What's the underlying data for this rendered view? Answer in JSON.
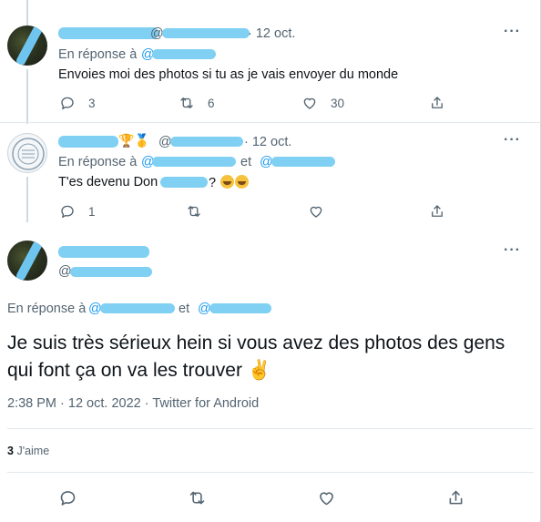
{
  "tweet1": {
    "handle_prefix": "@",
    "date": "· 12 oct.",
    "reply_label": "En réponse à",
    "reply_at": "@",
    "text": "Envoies moi des photos si tu as je vais envoyer du monde",
    "replies": "3",
    "retweets": "6",
    "likes": "30"
  },
  "tweet2": {
    "badges": "🏆🥇",
    "handle_prefix": "@",
    "date": "· 12 oct.",
    "reply_label": "En réponse à",
    "reply_at1": "@",
    "reply_and": "et",
    "reply_at2": "@",
    "text_start": "T'es devenu Don",
    "text_end": "?",
    "replies": "1"
  },
  "main_tweet": {
    "handle_prefix": "@",
    "reply_label": "En réponse à",
    "reply_at1": "@",
    "reply_and": "et",
    "reply_at2": "@",
    "text": "Je suis très sérieux hein si vous avez des photos des gens qui font ça on va les trouver",
    "emoji": "✌️",
    "timestamp": "2:38 PM · 12 oct. 2022 · Twitter for Android",
    "likes_count": "3",
    "likes_label": "J'aime"
  },
  "icons": {
    "more": "more-icon",
    "reply": "reply-icon",
    "retweet": "retweet-icon",
    "like": "like-icon",
    "share": "share-icon"
  }
}
